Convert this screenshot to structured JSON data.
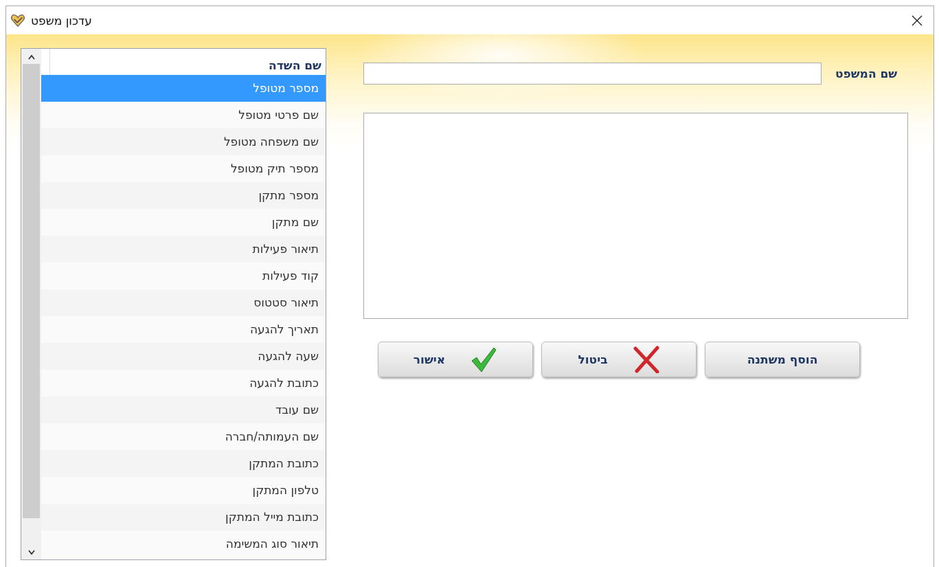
{
  "window": {
    "title": "עדכון משפט"
  },
  "field_list": {
    "header": "שם השדה",
    "items": [
      {
        "label": "מספר מטופל",
        "selected": true
      },
      {
        "label": "שם פרטי מטופל",
        "selected": false
      },
      {
        "label": "שם משפחה מטופל",
        "selected": false
      },
      {
        "label": "מספר תיק מטופל",
        "selected": false
      },
      {
        "label": "מספר מתקן",
        "selected": false
      },
      {
        "label": "שם מתקן",
        "selected": false
      },
      {
        "label": "תיאור פעילות",
        "selected": false
      },
      {
        "label": "קוד פעילות",
        "selected": false
      },
      {
        "label": "תיאור סטטוס",
        "selected": false
      },
      {
        "label": "תאריך להגעה",
        "selected": false
      },
      {
        "label": "שעה להגעה",
        "selected": false
      },
      {
        "label": "כתובת להגעה",
        "selected": false
      },
      {
        "label": "שם עובד",
        "selected": false
      },
      {
        "label": "שם העמותה/חברה",
        "selected": false
      },
      {
        "label": "כתובת המתקן",
        "selected": false
      },
      {
        "label": "טלפון המתקן",
        "selected": false
      },
      {
        "label": "כתובת מייל המתקן",
        "selected": false
      },
      {
        "label": "תיאור סוג המשימה",
        "selected": false
      }
    ]
  },
  "sentence_name": {
    "label": "שם המשפט"
  },
  "buttons": [
    {
      "label": "הוסף משתנה",
      "kind": "add"
    },
    {
      "label": "ביטול",
      "kind": "cancel"
    },
    {
      "label": "אישור",
      "kind": "ok"
    }
  ]
}
